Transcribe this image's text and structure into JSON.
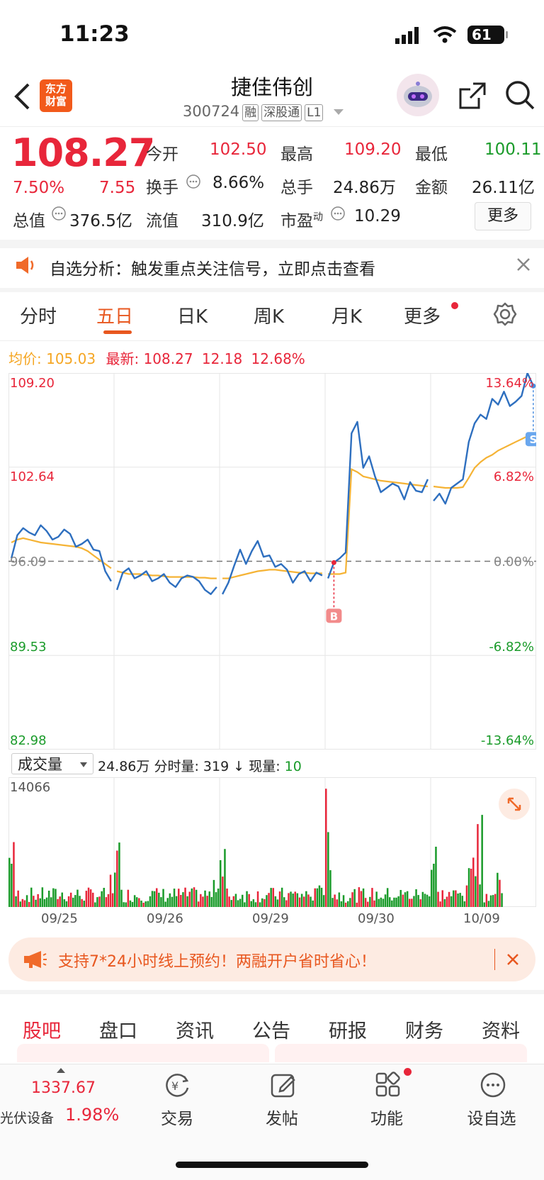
{
  "status_bar": {
    "time": "11:23",
    "battery": "61"
  },
  "header": {
    "logo_text_1": "东方",
    "logo_text_2": "财富",
    "stock_name": "捷佳伟创",
    "stock_code": "300724",
    "tags": [
      "融",
      "深股通",
      "L1"
    ]
  },
  "quote": {
    "price": "108.27",
    "change_pct": "7.50%",
    "change": "7.55",
    "open_label": "今开",
    "open": "102.50",
    "high_label": "最高",
    "high": "109.20",
    "low_label": "最低",
    "low": "100.11",
    "turnover_label": "换手",
    "turnover": "8.66%",
    "volume_label": "总手",
    "volume": "24.86万",
    "amount_label": "金额",
    "amount": "26.11亿",
    "mcap_label": "总值",
    "mcap": "376.5亿",
    "float_label": "流值",
    "float": "310.9亿",
    "pe_label": "市盈",
    "pe_sup": "动",
    "pe": "10.29",
    "more_label": "更多"
  },
  "notice": {
    "text": "自选分析：触发重点关注信号，立即点击查看"
  },
  "chart_tabs": {
    "items": [
      "分时",
      "五日",
      "日K",
      "周K",
      "月K",
      "更多"
    ],
    "active": "五日"
  },
  "chart_info": {
    "avg_label": "均价:",
    "avg": "105.03",
    "latest_label": "最新:",
    "latest": "108.27",
    "latest_change": "12.18",
    "latest_pct": "12.68%"
  },
  "chart_data": {
    "type": "line",
    "y_left_ticks": [
      "109.20",
      "102.64",
      "96.09",
      "89.53",
      "82.98"
    ],
    "y_right_ticks": [
      "13.64%",
      "6.82%",
      "0.00%",
      "-6.82%",
      "-13.64%"
    ],
    "ylim": [
      82.98,
      109.2
    ],
    "x_days": [
      "09/25",
      "09/26",
      "09/29",
      "09/30",
      "10/09"
    ],
    "series": [
      {
        "values": [
          96.3,
          97.9,
          98.4,
          98.1,
          97.9,
          98.6,
          98.2,
          97.6,
          97.8,
          98.3,
          98.0,
          97.1,
          97.3,
          97.6,
          96.9,
          96.8,
          95.4,
          94.7,
          94.1,
          95.3,
          95.6,
          94.9,
          95.1,
          95.4,
          94.7,
          94.9,
          95.2,
          94.6,
          94.3,
          94.9,
          95.1,
          95.0,
          94.7,
          94.1,
          93.8,
          94.3,
          93.8,
          94.6,
          95.8,
          96.9,
          95.9,
          96.8,
          97.5,
          96.4,
          96.5,
          95.7,
          95.9,
          95.5,
          94.6,
          95.2,
          95.4,
          94.7,
          95.3,
          95.1,
          94.9,
          96.0,
          96.3,
          96.7,
          105.0,
          105.8,
          102.6,
          103.4,
          102.0,
          100.9,
          101.2,
          101.5,
          101.3,
          100.4,
          101.6,
          101.0,
          100.9,
          101.8,
          100.3,
          100.8,
          100.1,
          101.2,
          101.5,
          101.8,
          104.4,
          105.7,
          106.3,
          106.0,
          107.4,
          107.0,
          107.9,
          106.9,
          107.2,
          107.6,
          109.2,
          108.3
        ]
      },
      {
        "values": [
          97.4,
          97.6,
          97.7,
          97.6,
          97.5,
          97.4,
          97.35,
          97.3,
          97.25,
          97.2,
          97.15,
          97.1,
          97.0,
          96.8,
          96.5,
          96.2,
          95.9,
          95.6,
          95.4,
          95.3,
          95.2,
          95.2,
          95.2,
          95.15,
          95.1,
          95.1,
          95.05,
          95.0,
          95.0,
          95.0,
          95.0,
          95.0,
          94.95,
          94.95,
          94.9,
          94.9,
          94.9,
          94.9,
          95.0,
          95.1,
          95.2,
          95.3,
          95.4,
          95.45,
          95.5,
          95.5,
          95.45,
          95.4,
          95.35,
          95.3,
          95.3,
          95.25,
          95.25,
          95.25,
          95.2,
          95.2,
          95.2,
          95.3,
          102.5,
          102.3,
          102.0,
          101.9,
          101.8,
          101.7,
          101.65,
          101.6,
          101.55,
          101.5,
          101.45,
          101.4,
          101.35,
          101.3,
          101.3,
          101.25,
          101.2,
          101.2,
          101.2,
          101.25,
          101.9,
          102.6,
          103.0,
          103.3,
          103.5,
          103.8,
          104.0,
          104.2,
          104.4,
          104.6,
          104.8,
          105.03
        ]
      }
    ],
    "markers": [
      {
        "label": "B"
      },
      {
        "label": "S"
      }
    ]
  },
  "volume": {
    "selector": "成交量",
    "total": "24.86万",
    "tick_label": "分时量:",
    "tick_value": "319",
    "arrow": "↓",
    "current_label": "现量:",
    "current": "10",
    "max": "14066"
  },
  "banner": {
    "text": "支持7*24小时线上预约！两融开户省时省心！"
  },
  "info_tabs": {
    "items": [
      "股吧",
      "盘口",
      "资讯",
      "公告",
      "研报",
      "财务",
      "资料"
    ],
    "active": "股吧"
  },
  "bottom_nav": {
    "index_value": "1337.67",
    "index_name": "光伏设备",
    "index_pct": "1.98%",
    "trade": "交易",
    "post": "发帖",
    "function": "功能",
    "add_watch": "设自选"
  },
  "colors": {
    "up": "#e8263a",
    "down": "#1a9b2a",
    "accent": "#e8571f",
    "price_line": "#2e6fbf",
    "avg_line": "#f5b335"
  }
}
